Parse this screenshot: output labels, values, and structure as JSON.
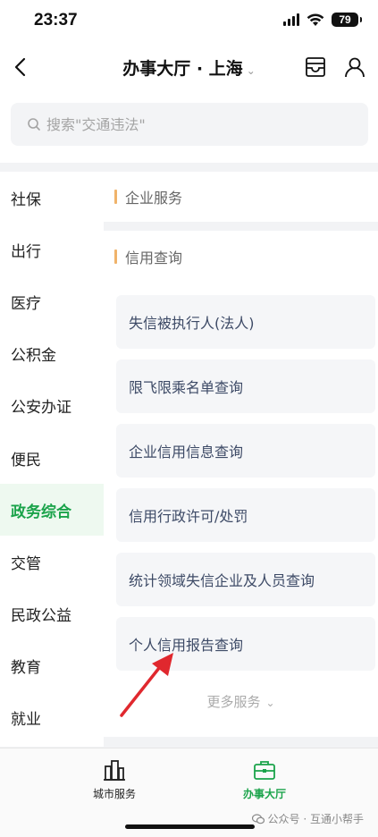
{
  "status": {
    "time": "23:37",
    "battery": "79"
  },
  "header": {
    "title": "办事大厅 · 上海"
  },
  "search": {
    "placeholder": "搜索\"交通违法\""
  },
  "sidebar": {
    "items": [
      {
        "label": "社保"
      },
      {
        "label": "出行"
      },
      {
        "label": "医疗"
      },
      {
        "label": "公积金"
      },
      {
        "label": "公安办证"
      },
      {
        "label": "便民"
      },
      {
        "label": "政务综合"
      },
      {
        "label": "交管"
      },
      {
        "label": "民政公益"
      },
      {
        "label": "教育"
      },
      {
        "label": "就业"
      }
    ],
    "active_index": 6
  },
  "content": {
    "section1": {
      "title": "企业服务"
    },
    "section2": {
      "title": "信用查询",
      "items": [
        {
          "label": "失信被执行人(法人)"
        },
        {
          "label": "限飞限乘名单查询"
        },
        {
          "label": "企业信用信息查询"
        },
        {
          "label": "信用行政许可/处罚"
        },
        {
          "label": "统计领域失信企业及人员查询"
        },
        {
          "label": "个人信用报告查询"
        }
      ],
      "more": "更多服务"
    }
  },
  "tabbar": {
    "tabs": [
      {
        "label": "城市服务"
      },
      {
        "label": "办事大厅"
      }
    ]
  },
  "watermark": {
    "text": "公众号 · 互通小帮手"
  },
  "colors": {
    "accent": "#1aa34a",
    "section_bar": "#f0b36a",
    "annotation_arrow": "#e0282e"
  }
}
